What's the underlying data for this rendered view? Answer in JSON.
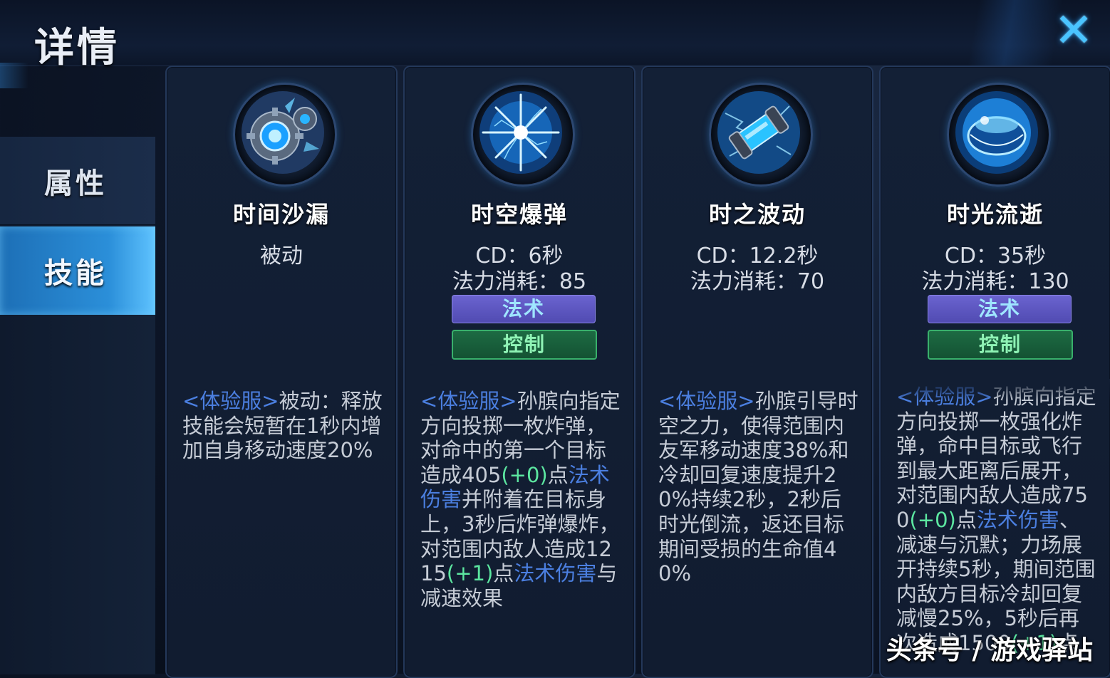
{
  "header": {
    "title": "详情",
    "close_icon": "close-icon"
  },
  "sidebar": {
    "items": [
      {
        "label": "属性",
        "active": false
      },
      {
        "label": "技能",
        "active": true
      }
    ]
  },
  "skills": [
    {
      "name": "时间沙漏",
      "icon": "gear-hourglass-icon",
      "meta1": "被动",
      "meta2": "",
      "desc": [
        {
          "t": "<体验服>",
          "c": "blue"
        },
        {
          "t": "被动：释放技能会短暂在1秒内增加自身移动速度20%",
          "c": ""
        }
      ]
    },
    {
      "name": "时空爆弹",
      "icon": "starburst-icon",
      "meta1": "CD：6秒",
      "meta2": "法力消耗：85",
      "tags": [
        "法术",
        "控制"
      ],
      "desc": [
        {
          "t": "<体验服>",
          "c": "blue"
        },
        {
          "t": "孙膑向指定方向投掷一枚炸弹，对命中的第一个目标造成405",
          "c": ""
        },
        {
          "t": "(+0)",
          "c": "green"
        },
        {
          "t": "点",
          "c": ""
        },
        {
          "t": "法术伤害",
          "c": "blue"
        },
        {
          "t": "并附着在目标身上，3秒后炸弹爆炸，对范围内敌人造成1215",
          "c": ""
        },
        {
          "t": "(+1)",
          "c": "green"
        },
        {
          "t": "点",
          "c": ""
        },
        {
          "t": "法术伤害",
          "c": "blue"
        },
        {
          "t": "与减速效果",
          "c": ""
        }
      ]
    },
    {
      "name": "时之波动",
      "icon": "capsule-icon",
      "meta1": "CD：12.2秒",
      "meta2": "法力消耗：70",
      "desc": [
        {
          "t": "<体验服>",
          "c": "blue"
        },
        {
          "t": "孙膑引导时空之力，使得范围内友军移动速度38%和冷却回复速度提升20%持续2秒，2秒后时光倒流，返还目标期间受损的生命值40%",
          "c": ""
        }
      ]
    },
    {
      "name": "时光流逝",
      "icon": "energy-sphere-icon",
      "meta1": "CD：35秒",
      "meta2": "法力消耗：130",
      "tags": [
        "法术",
        "控制"
      ],
      "desc": [
        {
          "t": "<体验服>",
          "c": "blue"
        },
        {
          "t": "孙膑向指定方向投掷一枚强化炸弹，命中目标或飞行到最大距离后展开，对范围内敌人造成750",
          "c": ""
        },
        {
          "t": "(+0)",
          "c": "green"
        },
        {
          "t": "点",
          "c": ""
        },
        {
          "t": "法术伤害",
          "c": "blue"
        },
        {
          "t": "、减速与沉默；力场展开持续5秒，期间范围内敌方目标冷却回复减慢25%，5秒后再次造成1500",
          "c": ""
        },
        {
          "t": "(+1)",
          "c": "green"
        },
        {
          "t": "点",
          "c": ""
        }
      ]
    }
  ],
  "watermark": "头条号 / 游戏驿站",
  "colors": {
    "accent": "#4ac4ff",
    "tag_magic": "#5a55c0",
    "tag_control": "#1a6a42",
    "text_blue": "#4b7fe0",
    "text_green": "#5ce6a0"
  }
}
